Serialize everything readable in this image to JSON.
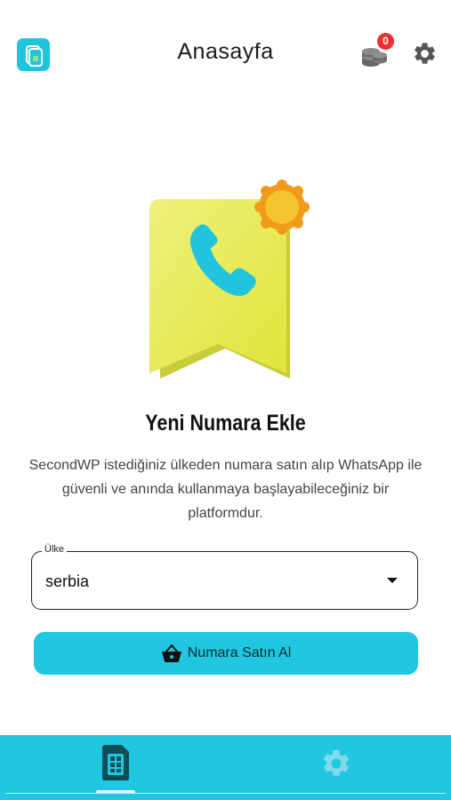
{
  "header": {
    "title": "Anasayfa",
    "coin_badge": "0",
    "icons": [
      "app-logo-icon",
      "coins-icon",
      "gear-icon"
    ]
  },
  "hero": {
    "headline": "Yeni Numara Ekle",
    "description": "SecondWP istediğiniz ülkeden numara satın alıp WhatsApp ile güvenli ve anında kullanmaya başlayabileceğiniz bir platformdur."
  },
  "country_select": {
    "label": "Ülke",
    "value": "serbia"
  },
  "buy_button": {
    "label": "Numara Satın Al"
  },
  "bottom_nav": {
    "items": [
      {
        "icon": "sim-card-icon",
        "active": true
      },
      {
        "icon": "settings-icon",
        "active": false
      }
    ]
  },
  "colors": {
    "accent": "#21c6e0",
    "badge": "#ef2f2f",
    "bookmark": "#ecee72",
    "sun": "#f2a114"
  }
}
